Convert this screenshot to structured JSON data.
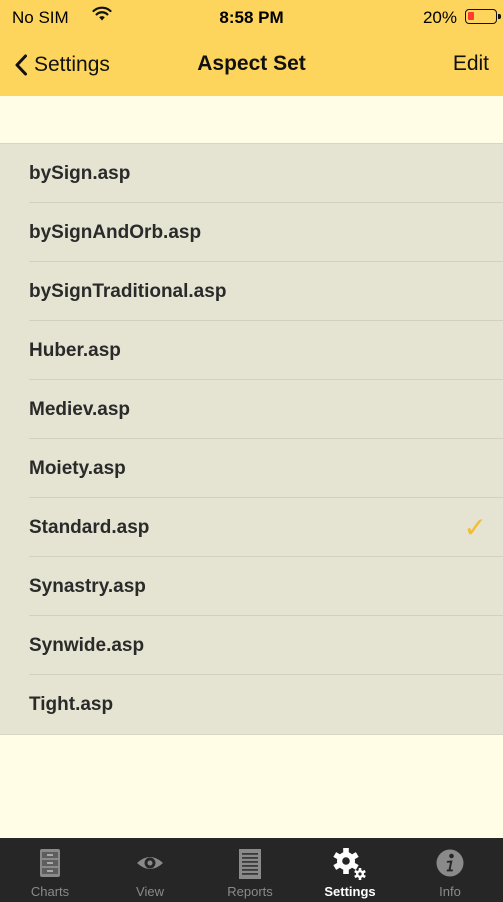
{
  "status_bar": {
    "carrier": "No SIM",
    "time": "8:58 PM",
    "battery": "20%"
  },
  "nav": {
    "back_label": "Settings",
    "title": "Aspect Set",
    "edit_label": "Edit"
  },
  "aspect_sets": [
    {
      "name": "bySign.asp",
      "selected": false
    },
    {
      "name": "bySignAndOrb.asp",
      "selected": false
    },
    {
      "name": "bySignTraditional.asp",
      "selected": false
    },
    {
      "name": "Huber.asp",
      "selected": false
    },
    {
      "name": "Mediev.asp",
      "selected": false
    },
    {
      "name": "Moiety.asp",
      "selected": false
    },
    {
      "name": "Standard.asp",
      "selected": true
    },
    {
      "name": "Synastry.asp",
      "selected": false
    },
    {
      "name": "Synwide.asp",
      "selected": false
    },
    {
      "name": "Tight.asp",
      "selected": false
    }
  ],
  "checkmark": "✓",
  "tabs": [
    {
      "label": "Charts",
      "icon": "cabinet-icon"
    },
    {
      "label": "View",
      "icon": "eye-icon"
    },
    {
      "label": "Reports",
      "icon": "document-icon"
    },
    {
      "label": "Settings",
      "icon": "gear-icon",
      "active": true
    },
    {
      "label": "Info",
      "icon": "info-icon"
    }
  ],
  "colors": {
    "header": "#fdd55c",
    "background": "#fffde6",
    "list": "#e5e3d1",
    "check": "#f5bc33",
    "tabbar": "#262626"
  }
}
